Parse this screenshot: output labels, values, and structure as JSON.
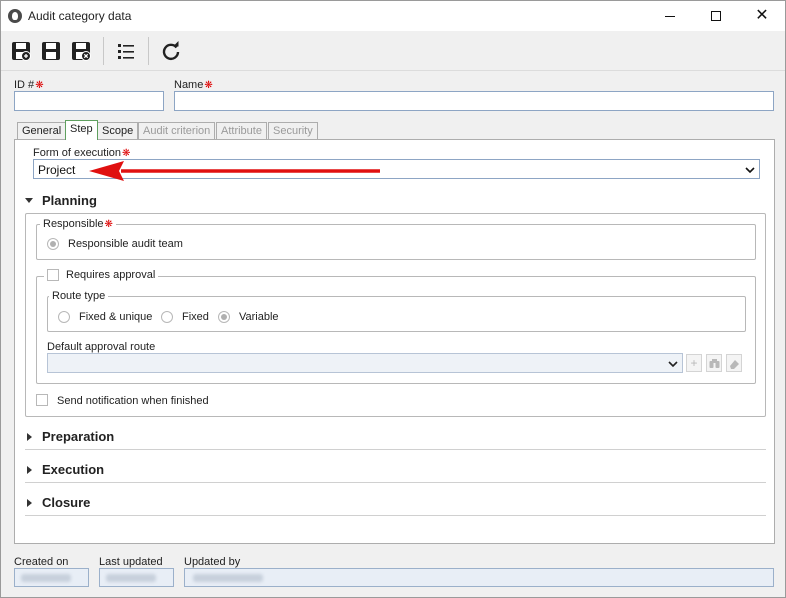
{
  "window": {
    "title": "Audit category data"
  },
  "toolbar": {
    "buttons": [
      {
        "icon": "save-new-icon"
      },
      {
        "icon": "save-icon"
      },
      {
        "icon": "save-close-icon"
      },
      {
        "icon": "list-icon"
      },
      {
        "icon": "refresh-icon"
      }
    ]
  },
  "form": {
    "id_label": "ID #",
    "name_label": "Name",
    "id_value": "",
    "name_value": ""
  },
  "tabs": [
    {
      "label": "General",
      "state": "normal"
    },
    {
      "label": "Step",
      "state": "active"
    },
    {
      "label": "Scope",
      "state": "normal"
    },
    {
      "label": "Audit criterion",
      "state": "disabled"
    },
    {
      "label": "Attribute",
      "state": "disabled"
    },
    {
      "label": "Security",
      "state": "disabled"
    }
  ],
  "step": {
    "form_of_execution_label": "Form of execution",
    "form_of_execution_value": "Project",
    "planning": {
      "title": "Planning",
      "responsible_legend": "Responsible",
      "responsible_option": "Responsible audit team",
      "requires_approval_label": "Requires approval",
      "route_type_legend": "Route type",
      "route_options": [
        "Fixed & unique",
        "Fixed",
        "Variable"
      ],
      "route_selected": "Variable",
      "default_route_label": "Default approval route",
      "default_route_value": "",
      "notify_label": "Send notification when finished"
    },
    "sections": [
      "Preparation",
      "Execution",
      "Closure"
    ]
  },
  "footer": {
    "created_on_label": "Created on",
    "last_updated_label": "Last updated",
    "updated_by_label": "Updated by"
  },
  "colors": {
    "accent_arrow": "#e01010",
    "required": "#dd0000",
    "field_border": "#8da5c4"
  }
}
